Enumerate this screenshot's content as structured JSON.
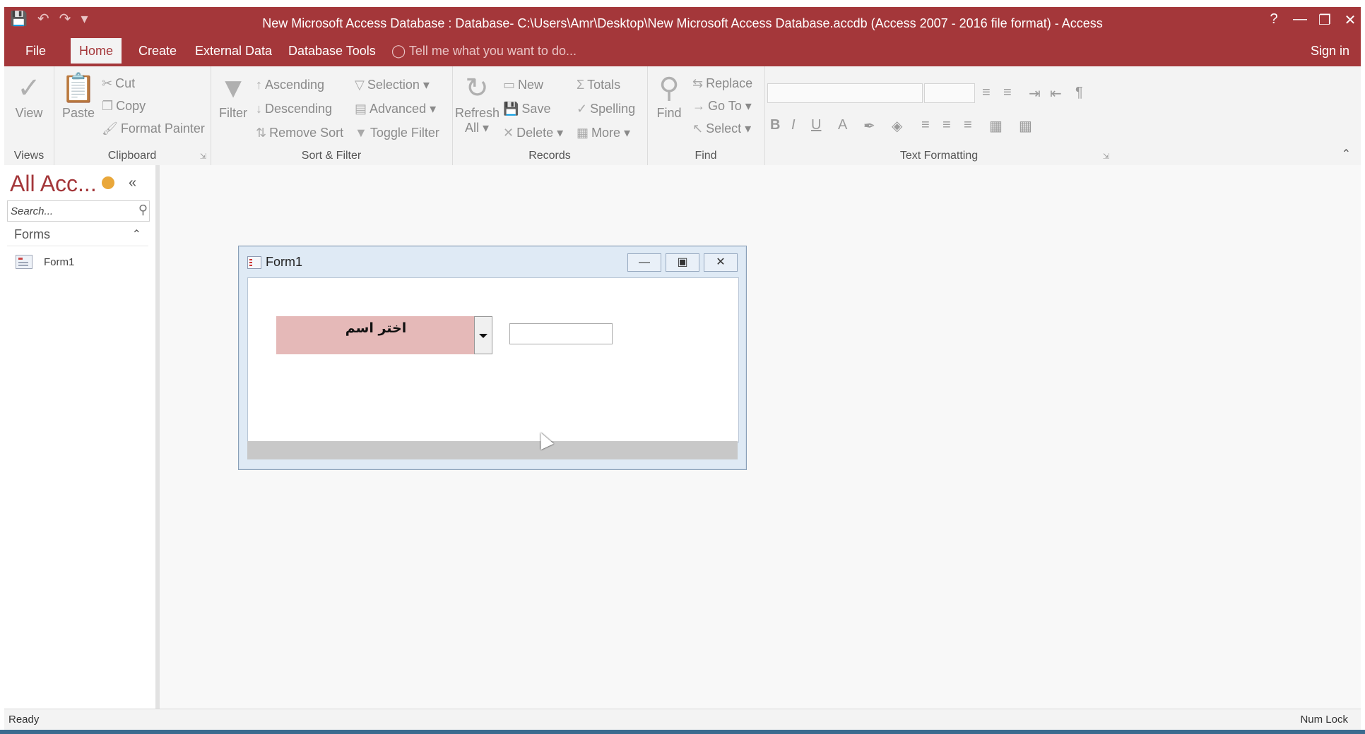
{
  "window": {
    "title": "New Microsoft Access Database : Database- C:\\Users\\Amr\\Desktop\\New Microsoft Access Database.accdb (Access 2007 - 2016 file format) - Access",
    "help": "?"
  },
  "tabs": [
    "File",
    "Home",
    "Create",
    "External Data",
    "Database Tools"
  ],
  "active_tab": "Home",
  "tell_me": "Tell me what you want to do...",
  "sign_in": "Sign in",
  "ribbon": {
    "views": {
      "label": "Views",
      "view": "View"
    },
    "clipboard": {
      "label": "Clipboard",
      "paste": "Paste",
      "cut": "Cut",
      "copy": "Copy",
      "format_painter": "Format Painter"
    },
    "sort_filter": {
      "label": "Sort & Filter",
      "filter": "Filter",
      "ascending": "Ascending",
      "descending": "Descending",
      "remove_sort": "Remove Sort",
      "selection": "Selection",
      "advanced": "Advanced",
      "toggle_filter": "Toggle Filter"
    },
    "records": {
      "label": "Records",
      "refresh": "Refresh",
      "refresh_all": "All",
      "new": "New",
      "save": "Save",
      "delete": "Delete",
      "totals": "Totals",
      "spelling": "Spelling",
      "more": "More"
    },
    "find": {
      "label": "Find",
      "find": "Find",
      "replace": "Replace",
      "goto": "Go To",
      "select": "Select"
    },
    "text_formatting": {
      "label": "Text Formatting"
    }
  },
  "nav": {
    "title": "All Acc...",
    "search_placeholder": "Search...",
    "section": "Forms",
    "items": [
      "Form1"
    ]
  },
  "form": {
    "title": "Form1",
    "combo_value": "اختر اسم",
    "textbox_value": ""
  },
  "status": {
    "left": "Ready",
    "right": "Num Lock"
  },
  "colors": {
    "accent": "#a4373a",
    "combo_bg": "#e5b9b8"
  }
}
